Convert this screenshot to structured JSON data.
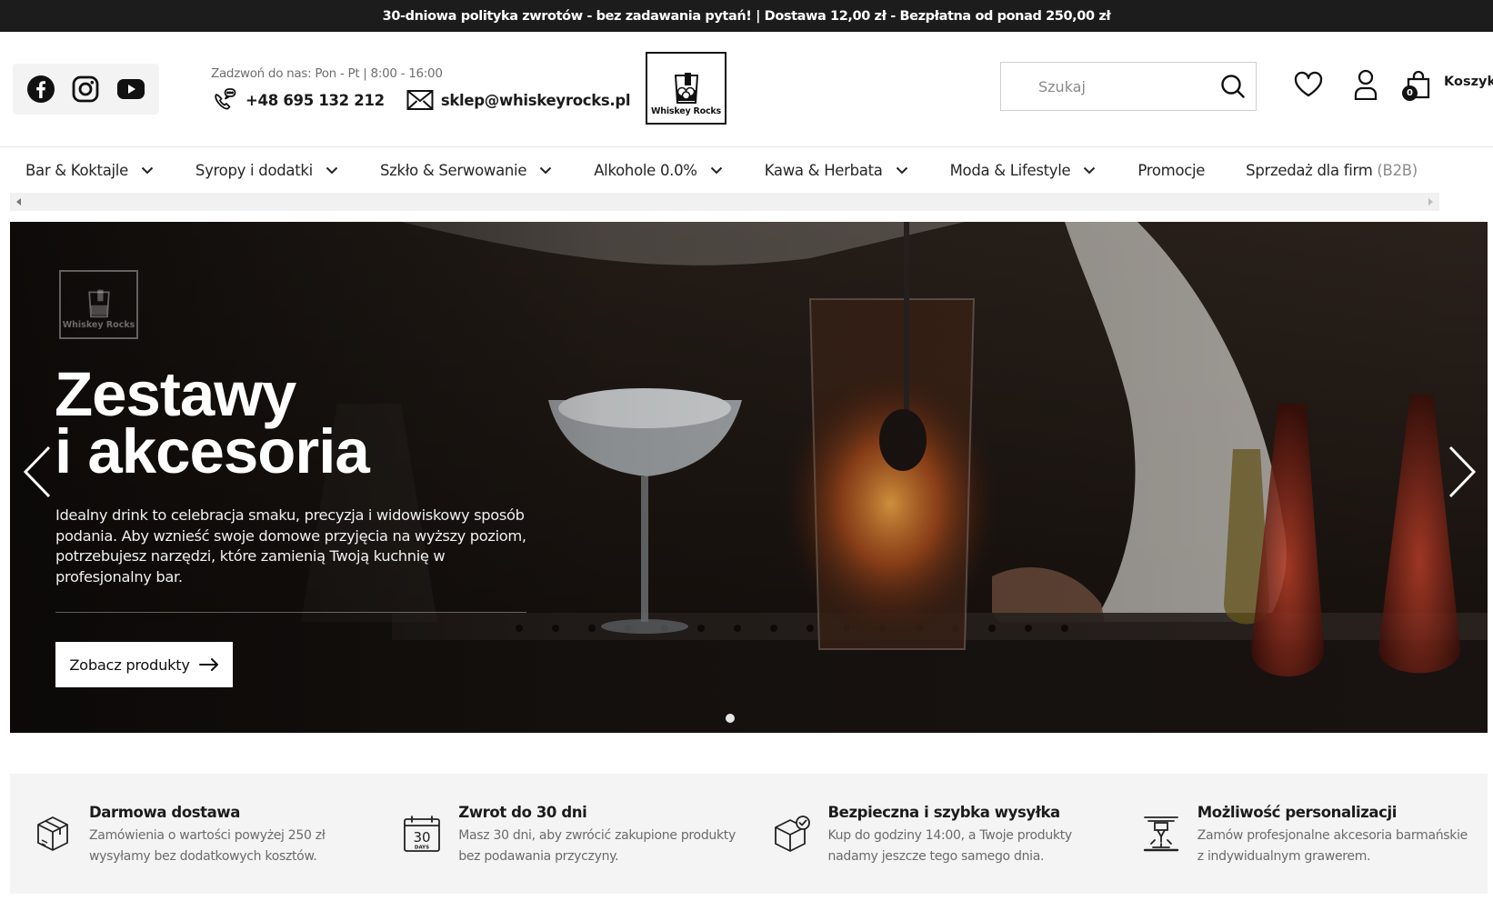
{
  "announcement": "30-dniowa polityka zwrotów - bez zadawania pytań! | Dostawa 12,00 zł - Bezpłatna od ponad 250,00 zł",
  "header": {
    "hours": "Zadzwoń do nas: Pon - Pt | 8:00 - 16:00",
    "phone": "+48 695 132 212",
    "email": "sklep@whiskeyrocks.pl",
    "logo_text": "Whiskey Rocks",
    "search_placeholder": "Szukaj",
    "cart_label": "Koszyk",
    "cart_count": "0"
  },
  "nav": {
    "items": [
      {
        "label": "Bar & Koktajle",
        "has_dropdown": true
      },
      {
        "label": "Syropy i dodatki",
        "has_dropdown": true
      },
      {
        "label": "Szkło & Serwowanie",
        "has_dropdown": true
      },
      {
        "label": "Alkohole 0.0%",
        "has_dropdown": true
      },
      {
        "label": "Kawa & Herbata",
        "has_dropdown": true
      },
      {
        "label": "Moda & Lifestyle",
        "has_dropdown": true
      },
      {
        "label": "Promocje",
        "has_dropdown": false
      },
      {
        "label": "Sprzedaż dla firm",
        "suffix": "(B2B)",
        "has_dropdown": false
      }
    ]
  },
  "hero": {
    "logo_text": "Whiskey Rocks",
    "title_line1": "Zestawy",
    "title_line2": "i akcesoria",
    "description": "Idealny drink to celebracja smaku, precyzja i widowiskowy sposób podania. Aby wznieść swoje domowe przyjęcia na wyższy poziom, potrzebujesz narzędzi, które zamienią Twoją kuchnię w profesjonalny bar.",
    "cta_label": "Zobacz produkty",
    "slide_count": 1,
    "active_slide": 1
  },
  "features": [
    {
      "icon": "box-icon",
      "title": "Darmowa dostawa",
      "desc": "Zamówienia o wartości powyżej 250 zł wysyłamy bez dodatkowych kosztów."
    },
    {
      "icon": "calendar-30-days-icon",
      "title": "Zwrot do 30 dni",
      "desc": "Masz 30 dni, aby zwrócić zakupione produkty bez podawania przyczyny.",
      "icon_number": "30",
      "icon_text": "DAYS"
    },
    {
      "icon": "package-check-icon",
      "title": "Bezpieczna i szybka wysyłka",
      "desc": "Kup do godziny 14:00, a Twoje produkty nadamy jeszcze tego samego dnia."
    },
    {
      "icon": "engraving-laser-icon",
      "title": "Możliwość personalizacji",
      "desc": "Zamów profesjonalne akcesoria barmańskie  z indywidualnym grawerem."
    }
  ],
  "colors": {
    "announcement_bg": "#1c1c1c",
    "text": "#1b1b1b",
    "muted": "#6b6b6b",
    "features_bg": "#f4f4f4"
  }
}
